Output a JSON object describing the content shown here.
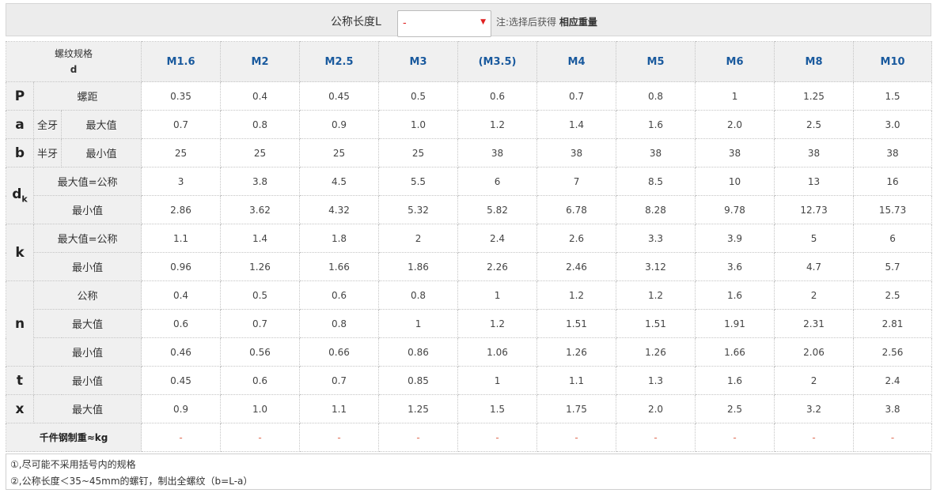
{
  "header": {
    "label": "公称长度L",
    "select_value": "-",
    "note_prefix": "注:选择后获得",
    "note_bold": "相应重量"
  },
  "table": {
    "corner_line1": "螺纹规格",
    "corner_line2": "d",
    "sizes": [
      "M1.6",
      "M2",
      "M2.5",
      "M3",
      "(M3.5)",
      "M4",
      "M5",
      "M6",
      "M8",
      "M10"
    ],
    "rows": {
      "P": {
        "symbol": "P",
        "label": "螺距",
        "values": [
          "0.35",
          "0.4",
          "0.45",
          "0.5",
          "0.6",
          "0.7",
          "0.8",
          "1",
          "1.25",
          "1.5"
        ]
      },
      "a": {
        "symbol": "a",
        "sub": "全牙",
        "label": "最大值",
        "values": [
          "0.7",
          "0.8",
          "0.9",
          "1.0",
          "1.2",
          "1.4",
          "1.6",
          "2.0",
          "2.5",
          "3.0"
        ]
      },
      "b": {
        "symbol": "b",
        "sub": "半牙",
        "label": "最小值",
        "values": [
          "25",
          "25",
          "25",
          "25",
          "38",
          "38",
          "38",
          "38",
          "38",
          "38"
        ]
      },
      "dk_max": {
        "symbol": "d",
        "symbol_sub": "k",
        "label": "最大值=公称",
        "values": [
          "3",
          "3.8",
          "4.5",
          "5.5",
          "6",
          "7",
          "8.5",
          "10",
          "13",
          "16"
        ]
      },
      "dk_min": {
        "label": "最小值",
        "values": [
          "2.86",
          "3.62",
          "4.32",
          "5.32",
          "5.82",
          "6.78",
          "8.28",
          "9.78",
          "12.73",
          "15.73"
        ]
      },
      "k_max": {
        "symbol": "k",
        "label": "最大值=公称",
        "values": [
          "1.1",
          "1.4",
          "1.8",
          "2",
          "2.4",
          "2.6",
          "3.3",
          "3.9",
          "5",
          "6"
        ]
      },
      "k_min": {
        "label": "最小值",
        "values": [
          "0.96",
          "1.26",
          "1.66",
          "1.86",
          "2.26",
          "2.46",
          "3.12",
          "3.6",
          "4.7",
          "5.7"
        ]
      },
      "n_nom": {
        "symbol": "n",
        "label": "公称",
        "values": [
          "0.4",
          "0.5",
          "0.6",
          "0.8",
          "1",
          "1.2",
          "1.2",
          "1.6",
          "2",
          "2.5"
        ]
      },
      "n_max": {
        "label": "最大值",
        "values": [
          "0.6",
          "0.7",
          "0.8",
          "1",
          "1.2",
          "1.51",
          "1.51",
          "1.91",
          "2.31",
          "2.81"
        ]
      },
      "n_min": {
        "label": "最小值",
        "values": [
          "0.46",
          "0.56",
          "0.66",
          "0.86",
          "1.06",
          "1.26",
          "1.26",
          "1.66",
          "2.06",
          "2.56"
        ]
      },
      "t": {
        "symbol": "t",
        "label": "最小值",
        "values": [
          "0.45",
          "0.6",
          "0.7",
          "0.85",
          "1",
          "1.1",
          "1.3",
          "1.6",
          "2",
          "2.4"
        ]
      },
      "x": {
        "symbol": "x",
        "label": "最大值",
        "values": [
          "0.9",
          "1.0",
          "1.1",
          "1.25",
          "1.5",
          "1.75",
          "2.0",
          "2.5",
          "3.2",
          "3.8"
        ]
      },
      "weight": {
        "label": "千件钢制重≈kg",
        "values": [
          "-",
          "-",
          "-",
          "-",
          "-",
          "-",
          "-",
          "-",
          "-",
          "-"
        ]
      }
    }
  },
  "notes": [
    "①,尽可能不采用括号内的规格",
    "②,公称长度＜35~45mm的螺钉，制出全螺纹（b=L-a）"
  ],
  "colors": {
    "size_header": "#1a5a9e",
    "dash": "#e06a50",
    "select_value": "#e02020"
  }
}
